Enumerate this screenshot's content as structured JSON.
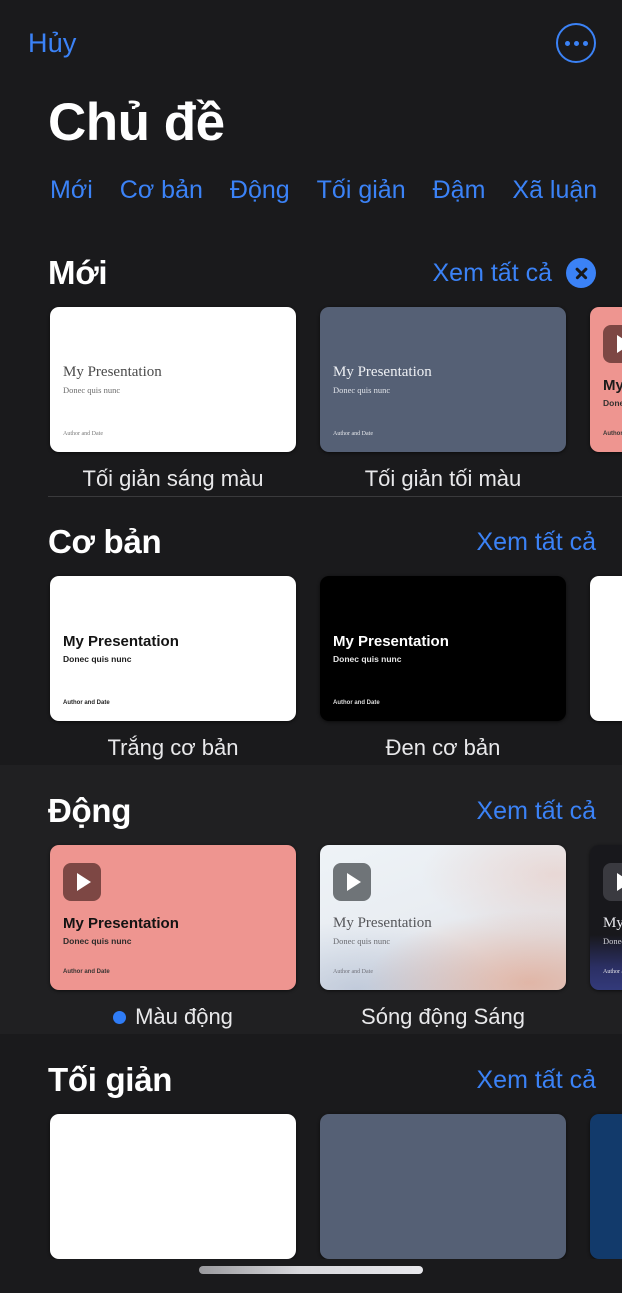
{
  "topbar": {
    "cancel_label": "Hủy",
    "more_icon": "more-circle-icon"
  },
  "header": {
    "title": "Chủ đề"
  },
  "tabs": [
    {
      "label": "Mới"
    },
    {
      "label": "Cơ bản"
    },
    {
      "label": "Động"
    },
    {
      "label": "Tối giản"
    },
    {
      "label": "Đậm"
    },
    {
      "label": "Xã luận"
    }
  ],
  "common": {
    "see_all_label": "Xem tất cả",
    "slide_title": "My Presentation",
    "slide_subtitle": "Donec quis nunc",
    "slide_footer": "Author and Date",
    "accent_color": "#3b82f6",
    "background_color": "#1a1a1c",
    "section_shade_color": "#202022"
  },
  "sections": [
    {
      "title": "Mới",
      "see_all": "Xem tất cả",
      "has_close": true,
      "cards": [
        {
          "caption": "Tối giản sáng màu",
          "selected": false
        },
        {
          "caption": "Tối giản tối màu",
          "selected": false
        },
        {
          "caption": "",
          "selected": false
        }
      ]
    },
    {
      "title": "Cơ bản",
      "see_all": "Xem tất cả",
      "has_close": false,
      "cards": [
        {
          "caption": "Trắng cơ bản",
          "selected": false
        },
        {
          "caption": "Đen cơ bản",
          "selected": false
        },
        {
          "caption": "",
          "selected": false
        }
      ]
    },
    {
      "title": "Động",
      "see_all": "Xem tất cả",
      "has_close": false,
      "cards": [
        {
          "caption": "Màu động",
          "selected": true
        },
        {
          "caption": "Sóng động Sáng",
          "selected": false
        },
        {
          "caption": "",
          "selected": false
        }
      ]
    },
    {
      "title": "Tối giản",
      "see_all": "Xem tất cả",
      "has_close": false,
      "cards": [
        {
          "caption": "",
          "selected": false
        },
        {
          "caption": "",
          "selected": false
        },
        {
          "caption": "",
          "selected": false
        }
      ]
    }
  ]
}
